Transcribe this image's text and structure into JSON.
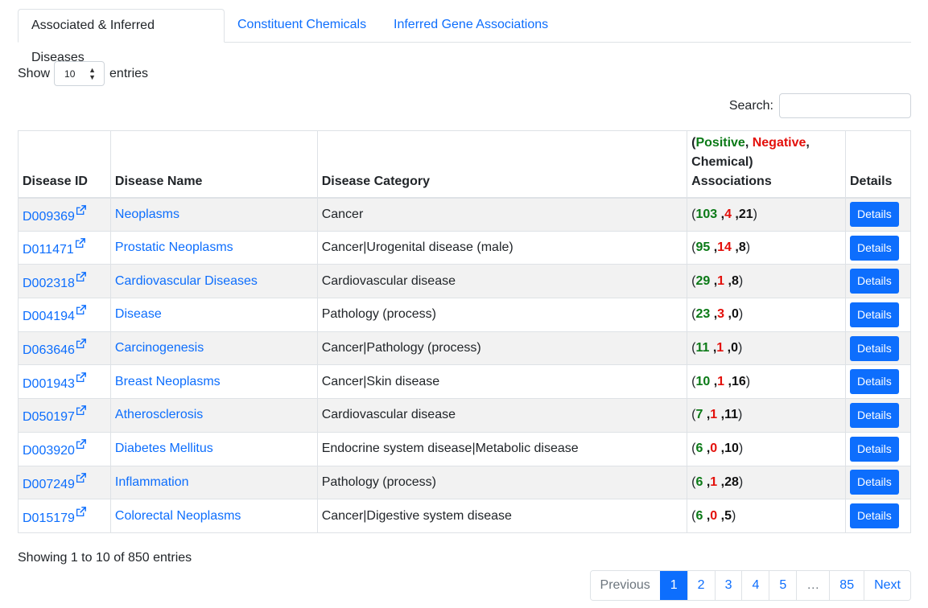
{
  "tabs": [
    {
      "label": "Associated & Inferred Diseases",
      "active": true
    },
    {
      "label": "Constituent Chemicals",
      "active": false
    },
    {
      "label": "Inferred Gene Associations",
      "active": false
    }
  ],
  "length_control": {
    "prefix": "Show",
    "selected": "10",
    "suffix": "entries"
  },
  "search": {
    "label": "Search:",
    "value": "",
    "placeholder": ""
  },
  "table": {
    "headers": {
      "disease_id": "Disease ID",
      "disease_name": "Disease Name",
      "disease_category": "Disease Category",
      "assoc_open": "(",
      "assoc_positive": "Positive",
      "assoc_comma1": ", ",
      "assoc_negative": "Negative",
      "assoc_comma2": ",",
      "assoc_chemical": "Chemical)",
      "assoc_label": "Associations",
      "details": "Details"
    },
    "rows": [
      {
        "id": "D009369",
        "name": "Neoplasms",
        "category": "Cancer",
        "positive": "103",
        "negative": "4",
        "chemical": "21",
        "button": "Details"
      },
      {
        "id": "D011471",
        "name": "Prostatic Neoplasms",
        "category": "Cancer|Urogenital disease (male)",
        "positive": "95",
        "negative": "14",
        "chemical": "8",
        "button": "Details"
      },
      {
        "id": "D002318",
        "name": "Cardiovascular Diseases",
        "category": "Cardiovascular disease",
        "positive": "29",
        "negative": "1",
        "chemical": "8",
        "button": "Details"
      },
      {
        "id": "D004194",
        "name": "Disease",
        "category": "Pathology (process)",
        "positive": "23",
        "negative": "3",
        "chemical": "0",
        "button": "Details"
      },
      {
        "id": "D063646",
        "name": "Carcinogenesis",
        "category": "Cancer|Pathology (process)",
        "positive": "11",
        "negative": "1",
        "chemical": "0",
        "button": "Details"
      },
      {
        "id": "D001943",
        "name": "Breast Neoplasms",
        "category": "Cancer|Skin disease",
        "positive": "10",
        "negative": "1",
        "chemical": "16",
        "button": "Details"
      },
      {
        "id": "D050197",
        "name": "Atherosclerosis",
        "category": "Cardiovascular disease",
        "positive": "7",
        "negative": "1",
        "chemical": "11",
        "button": "Details"
      },
      {
        "id": "D003920",
        "name": "Diabetes Mellitus",
        "category": "Endocrine system disease|Metabolic disease",
        "positive": "6",
        "negative": "0",
        "chemical": "10",
        "button": "Details"
      },
      {
        "id": "D007249",
        "name": "Inflammation",
        "category": "Pathology (process)",
        "positive": "6",
        "negative": "1",
        "chemical": "28",
        "button": "Details"
      },
      {
        "id": "D015179",
        "name": "Colorectal Neoplasms",
        "category": "Cancer|Digestive system disease",
        "positive": "6",
        "negative": "0",
        "chemical": "5",
        "button": "Details"
      }
    ]
  },
  "info": "Showing 1 to 10 of 850 entries",
  "pagination": {
    "previous": "Previous",
    "pages": [
      "1",
      "2",
      "3",
      "4",
      "5"
    ],
    "ellipsis": "…",
    "last": "85",
    "next": "Next",
    "current": "1"
  },
  "colors": {
    "link": "#0d6efd",
    "positive": "#0b7a17",
    "negative": "#e3100b",
    "button": "#0d6efd"
  },
  "icons": {
    "external_link": "external-link-icon",
    "select_arrow": "updown-arrow-icon"
  }
}
